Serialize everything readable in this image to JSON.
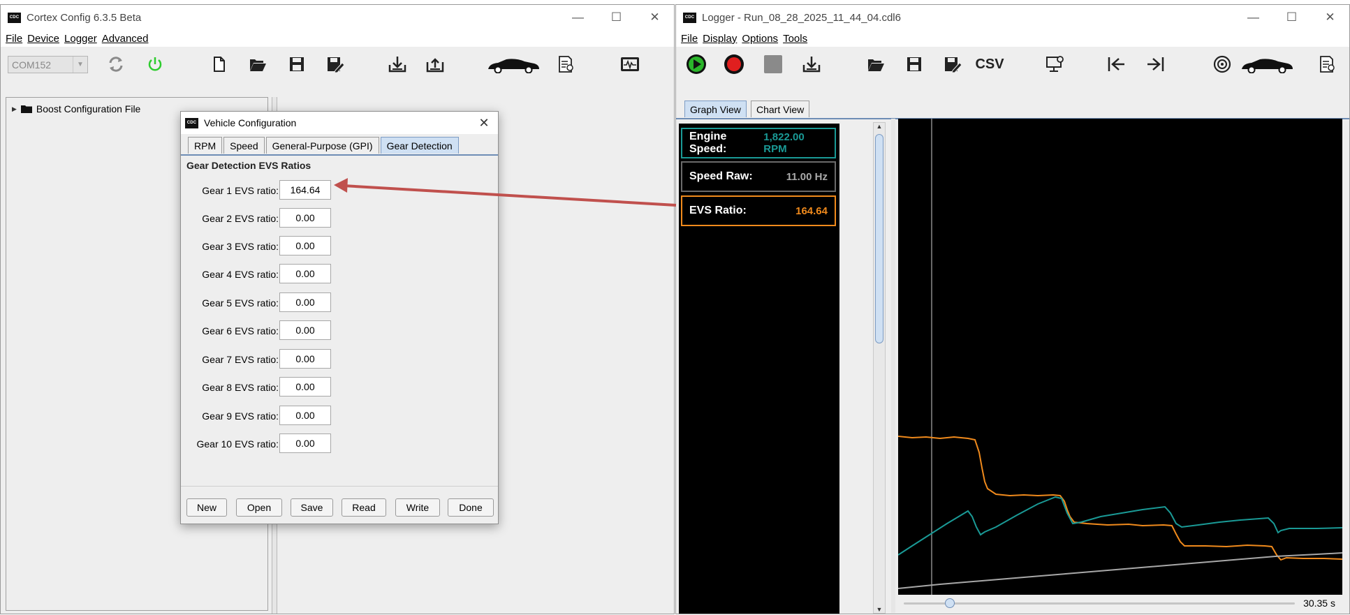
{
  "left_window": {
    "title": "Cortex Config 6.3.5 Beta",
    "menu": [
      "File",
      "Device",
      "Logger",
      "Advanced"
    ],
    "port_combo": "COM152",
    "tree_root": "Boost Configuration File"
  },
  "dialog": {
    "title": "Vehicle Configuration",
    "tabs": [
      "RPM",
      "Speed",
      "General-Purpose (GPI)",
      "Gear Detection"
    ],
    "active_tab": "Gear Detection",
    "section_title": "Gear Detection EVS Ratios",
    "gears": [
      {
        "label": "Gear 1 EVS ratio:",
        "value": "164.64"
      },
      {
        "label": "Gear 2 EVS ratio:",
        "value": "0.00"
      },
      {
        "label": "Gear 3 EVS ratio:",
        "value": "0.00"
      },
      {
        "label": "Gear 4 EVS ratio:",
        "value": "0.00"
      },
      {
        "label": "Gear 5 EVS ratio:",
        "value": "0.00"
      },
      {
        "label": "Gear 6 EVS ratio:",
        "value": "0.00"
      },
      {
        "label": "Gear 7 EVS ratio:",
        "value": "0.00"
      },
      {
        "label": "Gear 8 EVS ratio:",
        "value": "0.00"
      },
      {
        "label": "Gear 9 EVS ratio:",
        "value": "0.00"
      },
      {
        "label": "Gear 10 EVS ratio:",
        "value": "0.00"
      }
    ],
    "buttons": [
      "New",
      "Open",
      "Save",
      "Read",
      "Write",
      "Done"
    ]
  },
  "right_window": {
    "title": "Logger - Run_08_28_2025_11_44_04.cdl6",
    "menu": [
      "File",
      "Display",
      "Options",
      "Tools"
    ],
    "csv_label": "CSV",
    "tabs": [
      "Graph View",
      "Chart View"
    ],
    "active_tab": "Graph View",
    "channels": [
      {
        "name": "Engine Speed:",
        "value": "1,822.00 RPM",
        "color": "#1a9a96"
      },
      {
        "name": "Speed Raw:",
        "value": "11.00 Hz",
        "color": "#a8a8a8"
      },
      {
        "name": "EVS Ratio:",
        "value": "164.64",
        "color": "#f08a1c"
      }
    ],
    "time_label": "30.35 s"
  },
  "colors": {
    "engine_speed_trace": "#1a9a96",
    "evs_ratio_trace": "#f08a1c",
    "speed_raw_trace": "#a8a8a8",
    "annotation_arrow": "#c0504d",
    "play_green": "#2bb52b",
    "record_red": "#e01f1f"
  }
}
